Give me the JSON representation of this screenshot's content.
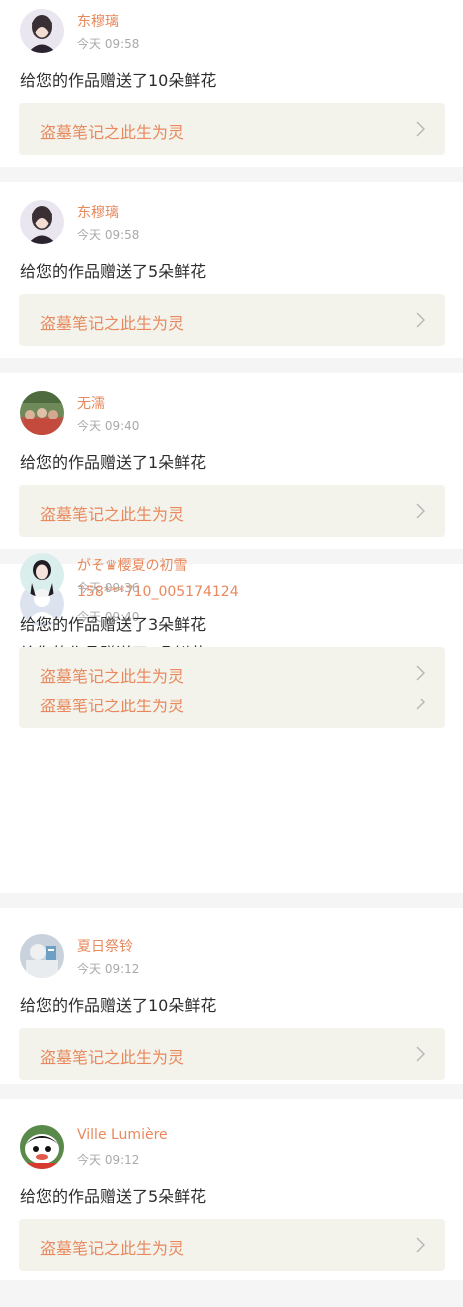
{
  "items": [
    {
      "name": "东穆璃",
      "time": "今天 09:58",
      "message": "给您的作品赠送了10朵鲜花",
      "work_title": "盗墓笔记之此生为灵",
      "avatar_icon": "avatar-photo-woman"
    },
    {
      "name": "东穆璃",
      "time": "今天 09:58",
      "message": "给您的作品赠送了5朵鲜花",
      "work_title": "盗墓笔记之此生为灵",
      "avatar_icon": "avatar-photo-woman"
    },
    {
      "name": "无濡",
      "time": "今天 09:40",
      "message": "给您的作品赠送了1朵鲜花",
      "work_title": "盗墓笔记之此生为灵",
      "avatar_icon": "avatar-photo-group"
    },
    {
      "name": "158***710_005174124",
      "time": "今天 09:40",
      "message": "给您的作品赠送了1朵鲜花",
      "work_title": "盗墓笔记之此生为灵",
      "avatar_icon": "default-user-icon"
    },
    {
      "name": "がそ♛樱夏の初雪",
      "time": "今天 09:36",
      "message": "给您的作品赠送了3朵鲜花",
      "work_title": "盗墓笔记之此生为灵",
      "avatar_icon": "avatar-photo-girl"
    },
    {
      "name": "夏日祭铃",
      "time": "今天 09:12",
      "message": "给您的作品赠送了10朵鲜花",
      "work_title": "盗墓笔记之此生为灵",
      "avatar_icon": "avatar-photo-doll"
    },
    {
      "name": "Ville Lumière",
      "time": "今天 09:12",
      "message": "给您的作品赠送了5朵鲜花",
      "work_title": "盗墓笔记之此生为灵",
      "avatar_icon": "avatar-cartoon"
    }
  ],
  "colors": {
    "accent": "#e8885c",
    "card_bg": "#f3f3ec",
    "page_bg": "#f5f5f5"
  }
}
